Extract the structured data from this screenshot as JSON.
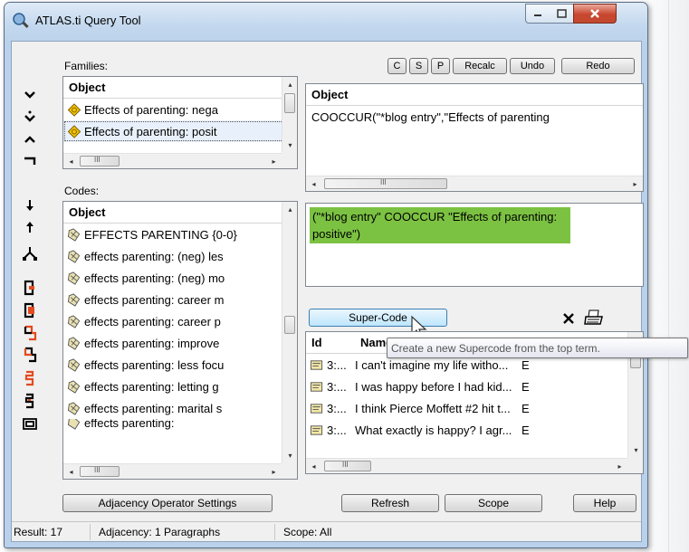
{
  "window": {
    "title": "ATLAS.ti Query Tool"
  },
  "toolbar_top": {
    "c": "C",
    "s": "S",
    "p": "P",
    "recalc": "Recalc",
    "undo": "Undo",
    "redo": "Redo"
  },
  "families": {
    "label": "Families:",
    "column": "Object",
    "items": [
      "Effects of parenting: nega",
      "Effects of parenting: posit"
    ]
  },
  "codes": {
    "label": "Codes:",
    "column": "Object",
    "items": [
      "EFFECTS PARENTING {0-0}",
      "effects parenting: (neg) les",
      "effects parenting: (neg) mo",
      "effects parenting: career m",
      "effects parenting: career p",
      "effects parenting: improve",
      "effects parenting: less focu",
      "effects parenting: letting g",
      "effects parenting: marital s",
      "effects parenting:"
    ]
  },
  "query": {
    "column": "Object",
    "item": "COOCCUR(\"*blog entry\",\"Effects of parenting"
  },
  "expression": {
    "text": "(\"*blog entry\" COOCCUR \"Effects of parenting: positive\")"
  },
  "supercode": {
    "label": "Super-Code",
    "tooltip": "Create a new Supercode from the top term."
  },
  "results": {
    "columns": [
      "Id",
      "Name"
    ],
    "rows": [
      {
        "id": "3:...",
        "name": "I can't imagine my life witho...",
        "c3": "E"
      },
      {
        "id": "3:...",
        "name": "I was happy before I had kid...",
        "c3": "E"
      },
      {
        "id": "3:...",
        "name": "I think Pierce Moffett #2 hit t...",
        "c3": "E"
      },
      {
        "id": "3:...",
        "name": "What exactly is happy? I agr...",
        "c3": "E"
      }
    ]
  },
  "buttons": {
    "adjacency": "Adjacency Operator Settings",
    "refresh": "Refresh",
    "scope": "Scope",
    "help": "Help"
  },
  "status": {
    "result": "Result: 17",
    "adjacency": "Adjacency: 1 Paragraphs",
    "scope": "Scope: All"
  },
  "scroll": {
    "left": "◂",
    "right": "▸",
    "up": "▴",
    "down": "▾",
    "grip": "III"
  },
  "colors": {
    "title_bg": "#c3d8ee",
    "expression_highlight": "#7cc242",
    "close_button": "#c8462e"
  }
}
